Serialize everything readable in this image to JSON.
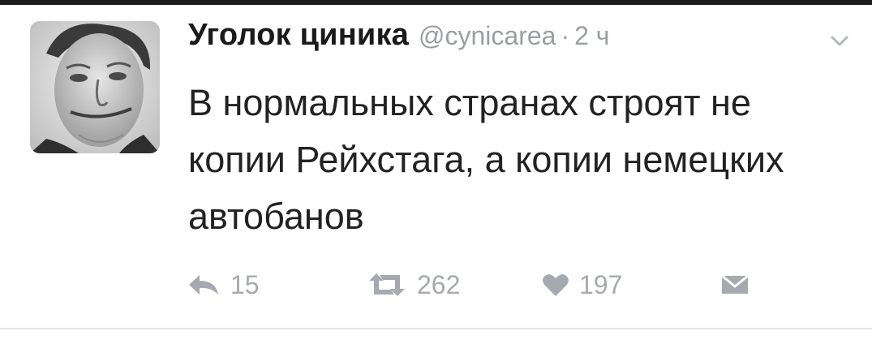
{
  "tweet": {
    "author_name": "Уголок циника",
    "author_handle": "@cynicarea",
    "separator": "·",
    "time": "2 ч",
    "text": "В нормальных странах строят не копии Рейхстага, а копии немецких автобанов"
  },
  "actions": {
    "reply_count": "15",
    "retweet_count": "262",
    "like_count": "197"
  },
  "icons": {
    "reply": "reply-icon",
    "retweet": "retweet-icon",
    "like": "heart-icon",
    "message": "envelope-icon",
    "menu": "chevron-down-icon"
  },
  "colors": {
    "text": "#222222",
    "muted": "#a6aab0",
    "top_bar": "#1b1b1b"
  }
}
